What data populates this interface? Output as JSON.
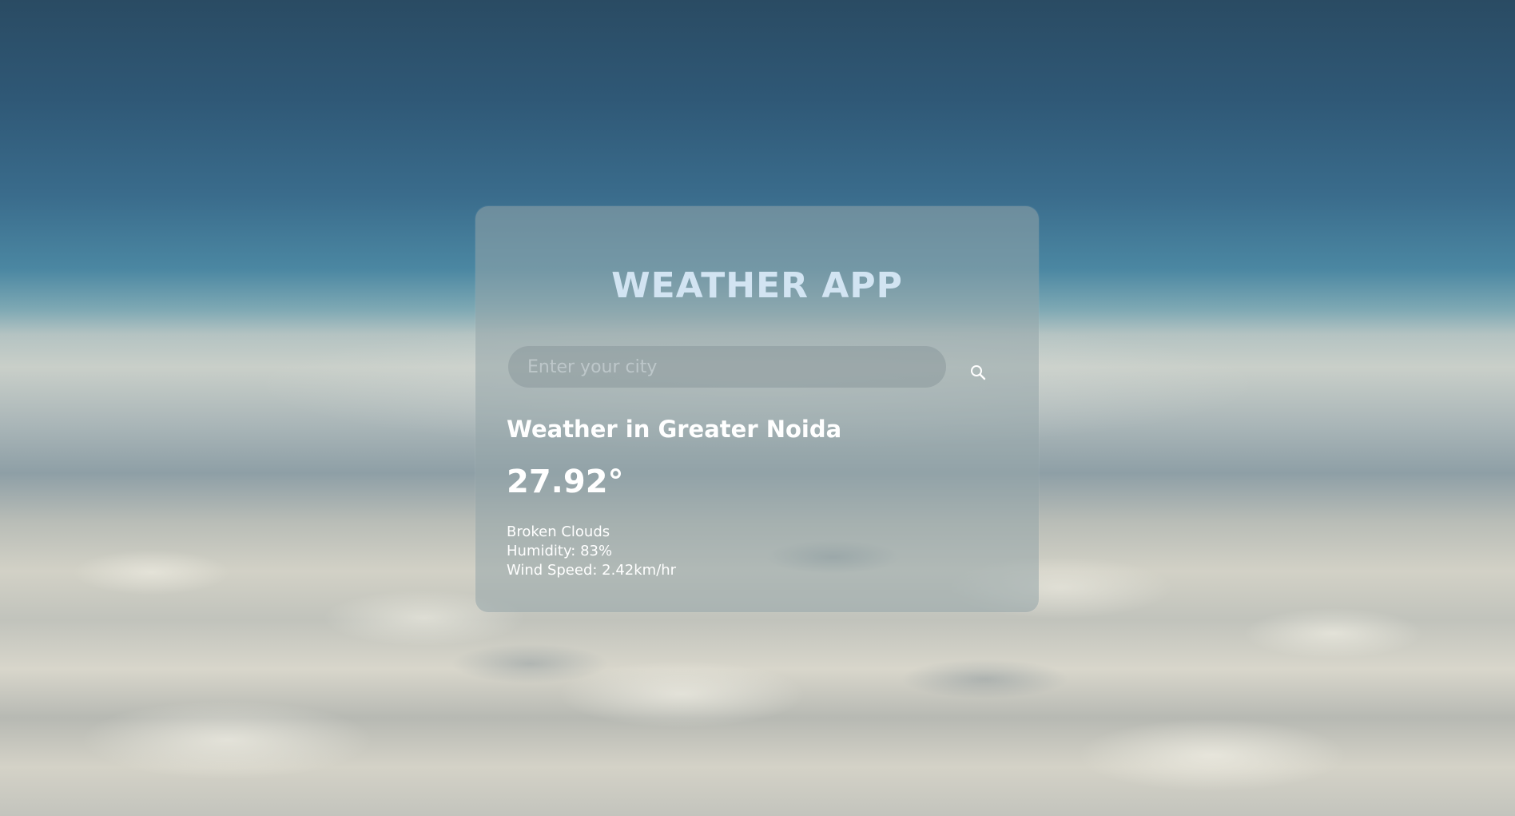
{
  "app": {
    "title": "WEATHER APP"
  },
  "search": {
    "placeholder": "Enter your city",
    "value": "",
    "icon": "search-icon"
  },
  "weather": {
    "heading": "Weather in Greater Noida",
    "temperature": "27.92°",
    "description": "Broken Clouds",
    "humidity": "Humidity: 83%",
    "wind": "Wind Speed: 2.42km/hr"
  },
  "colors": {
    "title": "#d2e4f2",
    "text": "#ffffff",
    "card_background": "rgba(150,165,170,0.55)"
  }
}
